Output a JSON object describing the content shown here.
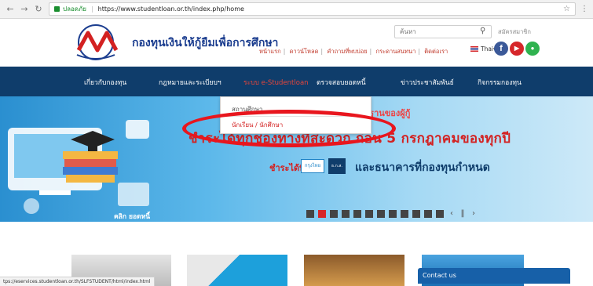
{
  "browser": {
    "security_label": "ปลอดภัย",
    "url": "https://www.studentloan.or.th/index.php/home"
  },
  "header": {
    "org_name": "กองทุนเงินให้กู้ยืมเพื่อการศึกษา",
    "search_placeholder": "ค้นหา",
    "login_link": "สมัครสมาชิก",
    "top_links": [
      "หน้าแรก",
      "ดาวน์โหลด",
      "คำถามที่พบบ่อย",
      "กระดานสนทนา",
      "ติดต่อเรา"
    ],
    "language": "Thai"
  },
  "nav": {
    "items": [
      "เกี่ยวกับกองทุน",
      "กฎหมายและระเบียบฯ",
      "ระบบ e-Studentloan",
      "ตรวจสอบยอดหนี้",
      "ข่าวประชาสัมพันธ์",
      "กิจกรรมกองทุน"
    ],
    "active_index": 2,
    "dropdown": [
      "สถานศึกษา",
      "นักเรียน / นักศึกษา"
    ]
  },
  "banner": {
    "headline_top": "ฐานของผู้กู้",
    "headline": "ชำระได้ทุกช่องทางที่สะดวก ก่อน 5 กรกฎาคมของทุกปี",
    "pay_label": "ชำระได้ที่",
    "bank1": "กรุงไทย",
    "bank2": "ธ.ก.ส.",
    "banks_text": "และธนาคารที่กองทุนกำหนด",
    "click_label": "คลิก ยอดหนี้",
    "slide_count": 12,
    "active_slide": 1
  },
  "footer": {
    "contact_label": "Contact us",
    "status_url": "tps://eservices.studentloan.or.th/SLFSTUDENT/html/index.html"
  },
  "colors": {
    "nav_bg": "#0f3d6b",
    "accent_red": "#d32121",
    "highlight_ring": "#e8161e"
  }
}
